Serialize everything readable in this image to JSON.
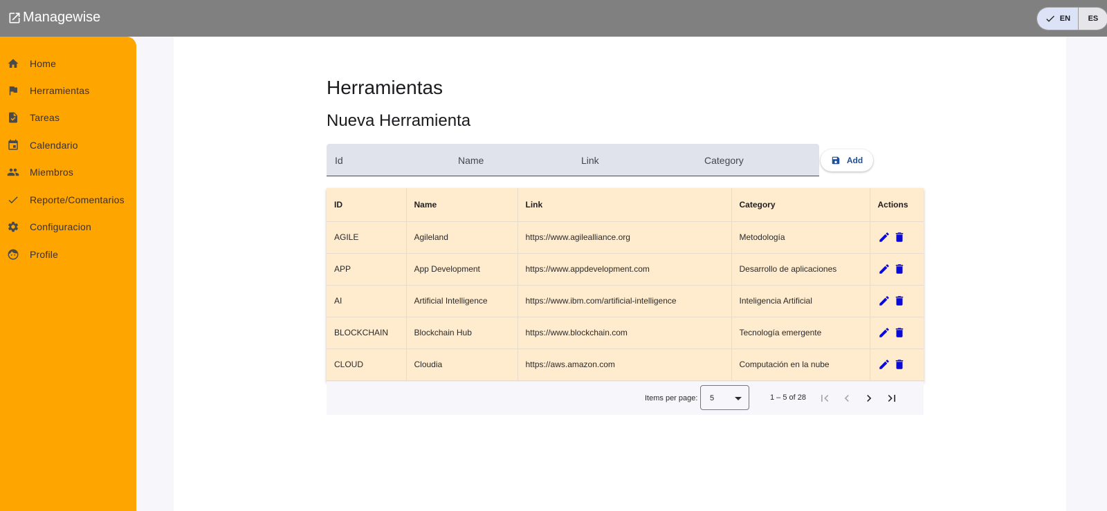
{
  "header": {
    "brand": "Managewise",
    "lang_en": "EN",
    "lang_es": "ES"
  },
  "sidebar": {
    "items": [
      {
        "label": "Home",
        "icon": "home-icon"
      },
      {
        "label": "Herramientas",
        "icon": "flag-icon"
      },
      {
        "label": "Tareas",
        "icon": "task-icon"
      },
      {
        "label": "Calendario",
        "icon": "calendar-icon"
      },
      {
        "label": "Miembros",
        "icon": "people-icon"
      },
      {
        "label": "Reporte/Comentarios",
        "icon": "check-icon"
      },
      {
        "label": "Configuracion",
        "icon": "gear-icon"
      },
      {
        "label": "Profile",
        "icon": "face-icon"
      }
    ]
  },
  "main": {
    "title": "Herramientas",
    "subtitle": "Nueva Herramienta",
    "form": {
      "id_placeholder": "Id",
      "name_placeholder": "Name",
      "link_placeholder": "Link",
      "category_placeholder": "Category",
      "add_label": "Add"
    },
    "table": {
      "headers": [
        "ID",
        "Name",
        "Link",
        "Category",
        "Actions"
      ],
      "rows": [
        [
          "AGILE",
          "Agileland",
          "https://www.agilealliance.org",
          "Metodología"
        ],
        [
          "APP",
          "App Development",
          "https://www.appdevelopment.com",
          "Desarrollo de aplicaciones"
        ],
        [
          "AI",
          "Artificial Intelligence",
          "https://www.ibm.com/artificial-intelligence",
          "Inteligencia Artificial"
        ],
        [
          "BLOCKCHAIN",
          "Blockchain Hub",
          "https://www.blockchain.com",
          "Tecnología emergente"
        ],
        [
          "CLOUD",
          "Cloudia",
          "https://aws.amazon.com",
          "Computación en la nube"
        ]
      ]
    },
    "paginator": {
      "items_per_page_label": "Items per page:",
      "page_size": "5",
      "range": "1 – 5 of 28"
    }
  },
  "colors": {
    "sidebar": "#ffa500",
    "topbar": "#808080",
    "table_bg": "#ffebcd",
    "action_icons": "#0a0ad6"
  }
}
